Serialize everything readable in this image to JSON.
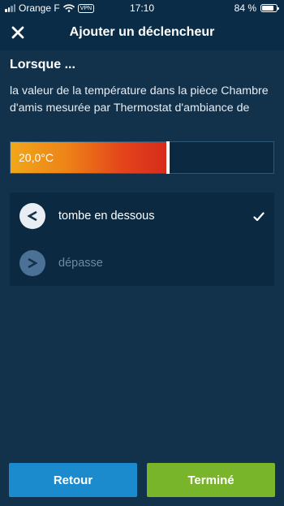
{
  "status_bar": {
    "carrier": "Orange F",
    "vpn": "VPN",
    "time": "17:10",
    "battery_text": "84 %",
    "battery_level": 0.84,
    "icons": [
      "signal-icon",
      "wifi-icon",
      "battery-icon"
    ]
  },
  "header": {
    "title": "Ajouter un déclencheur",
    "close_icon": "close-icon"
  },
  "condition": {
    "heading": "Lorsque ...",
    "description": "la valeur de la température  dans la pièce Chambre d'amis mesurée par Thermostat d'ambiance de"
  },
  "temperature": {
    "value_label": "20,0°C",
    "slider_fraction": 0.6
  },
  "options": [
    {
      "label": "tombe en dessous",
      "selected": true,
      "icon": "less-than-icon"
    },
    {
      "label": "dépasse",
      "selected": false,
      "icon": "greater-than-icon"
    }
  ],
  "buttons": {
    "back": "Retour",
    "done": "Terminé"
  },
  "colors": {
    "background": "#12324c",
    "header": "#0a2c47",
    "back_button": "#1c8bcd",
    "done_button": "#78b52a",
    "gradient_start": "#f0a71a",
    "gradient_end": "#d62a1b"
  }
}
